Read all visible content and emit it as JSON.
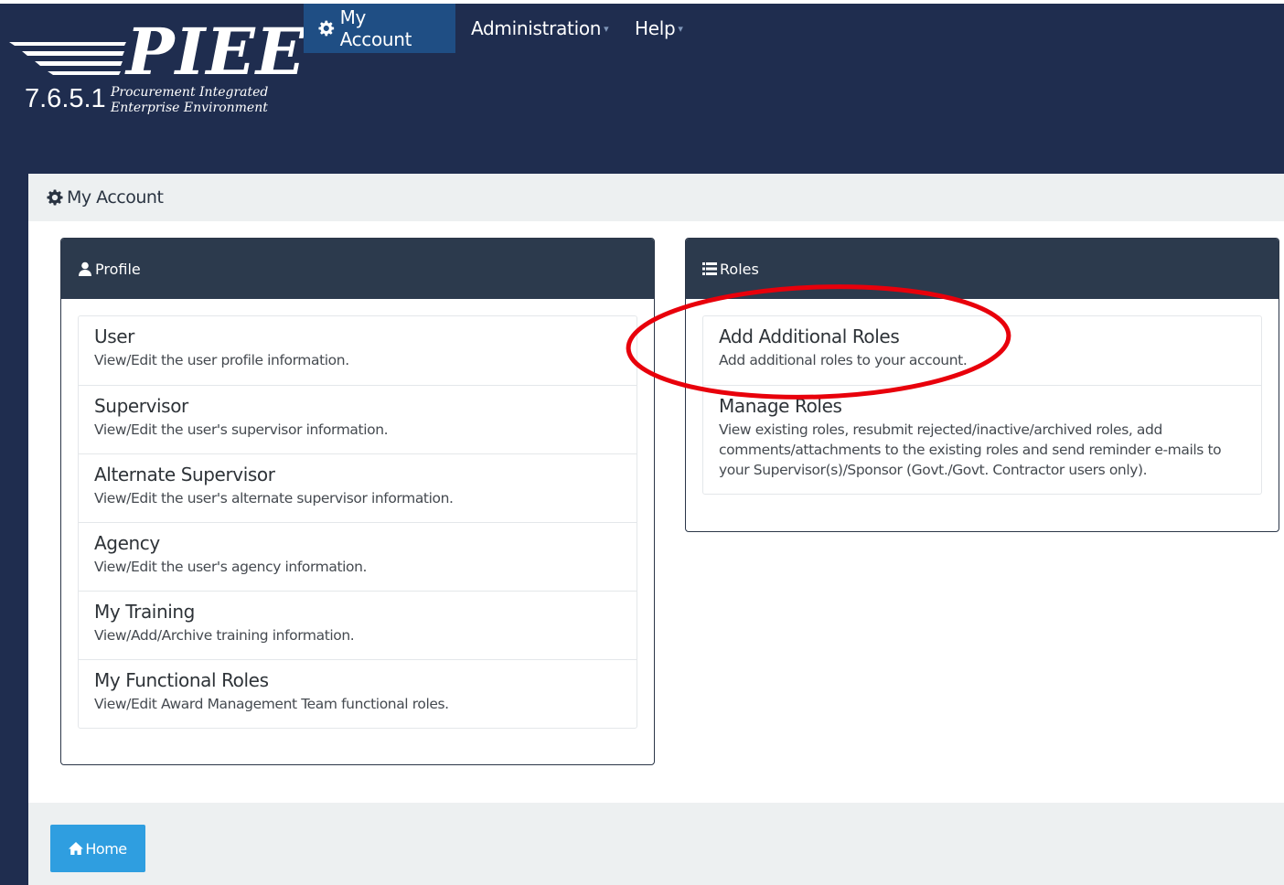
{
  "logo": {
    "brand": "PIEE",
    "version": "7.6.5.1",
    "tagline_line1": "Procurement Integrated",
    "tagline_line2": "Enterprise Environment"
  },
  "nav": {
    "my_account": "My Account",
    "administration": "Administration",
    "help": "Help",
    "caret": "▾"
  },
  "page": {
    "heading": "My Account"
  },
  "profile": {
    "title": "Profile",
    "items": [
      {
        "title": "User",
        "desc": "View/Edit the user profile information."
      },
      {
        "title": "Supervisor",
        "desc": "View/Edit the user's supervisor information."
      },
      {
        "title": "Alternate Supervisor",
        "desc": "View/Edit the user's alternate supervisor information."
      },
      {
        "title": "Agency",
        "desc": "View/Edit the user's agency information."
      },
      {
        "title": "My Training",
        "desc": "View/Add/Archive training information."
      },
      {
        "title": "My Functional Roles",
        "desc": "View/Edit Award Management Team functional roles."
      }
    ]
  },
  "roles": {
    "title": "Roles",
    "items": [
      {
        "title": "Add Additional Roles",
        "desc": "Add additional roles to your account."
      },
      {
        "title": "Manage Roles",
        "desc_line1": "View existing roles, resubmit rejected/inactive/archived roles, add",
        "desc_line2": "comments/attachments to the existing roles and send reminder e-mails to",
        "desc_line3": "your Supervisor(s)/Sponsor (Govt./Govt. Contractor users only)."
      }
    ]
  },
  "footer": {
    "home_label": "Home"
  },
  "colors": {
    "header_bg": "#1f2d4f",
    "active_tab": "#1f4e84",
    "card_header": "#2c3a4d",
    "home_button": "#2f9ee0",
    "annotation": "#e8000b"
  },
  "icons": [
    "gear-icon",
    "user-icon",
    "list-icon",
    "home-icon",
    "caret-down-icon"
  ]
}
